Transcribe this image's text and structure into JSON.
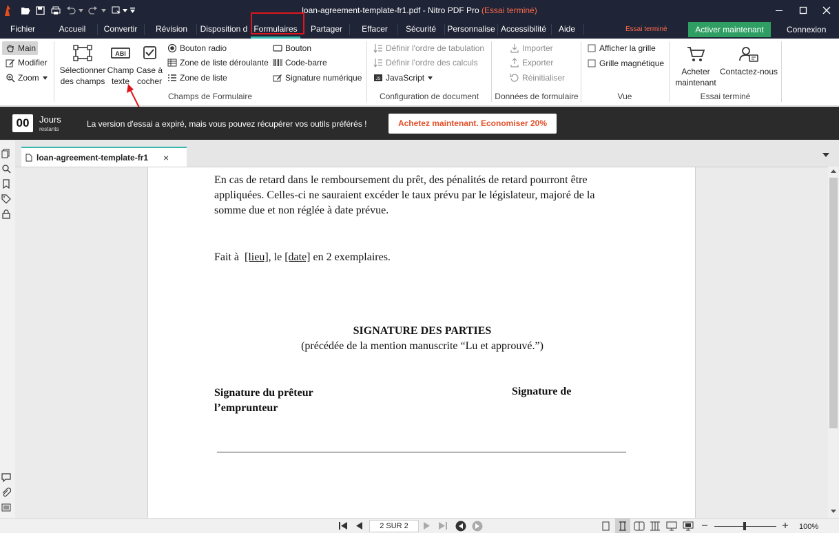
{
  "titlebar": {
    "filename": "loan-agreement-template-fr1.pdf - Nitro PDF Pro ",
    "trial": "(Essai terminé)"
  },
  "menu": {
    "tabs": [
      "Fichier",
      "Accueil",
      "Convertir",
      "Révision",
      "Disposition d",
      "Formulaires",
      "Partager",
      "Effacer",
      "Sécurité",
      "Personnalise",
      "Accessibilité",
      "Aide"
    ],
    "active": "Formulaires",
    "trial_label": "Essai terminé",
    "activate_label": "Activer maintenant",
    "connexion_label": "Connexion"
  },
  "ribbon": {
    "tools": {
      "main": "Main",
      "modifier": "Modifier",
      "zoom": "Zoom"
    },
    "fields": {
      "select_line1": "Sélectionner",
      "select_line2": "des champs",
      "text_line1": "Champ",
      "text_line2": "texte",
      "check_line1": "Case à",
      "check_line2": "cocher",
      "radio": "Bouton radio",
      "dropdown": "Zone de liste déroulante",
      "listbox": "Zone de liste",
      "button": "Bouton",
      "barcode": "Code-barre",
      "signature": "Signature numérique",
      "group": "Champs de Formulaire"
    },
    "docconfig": {
      "tab_order": "Définir l'ordre de tabulation",
      "calc_order": "Définir l'ordre des calculs",
      "javascript": "JavaScript",
      "group": "Configuration de document"
    },
    "formdata": {
      "import": "Importer",
      "export": "Exporter",
      "reset": "Réinitialiser",
      "group": "Données de formulaire"
    },
    "view": {
      "grid": "Afficher la grille",
      "magnetic": "Grille magnétique",
      "group": "Vue"
    },
    "trial": {
      "buy_line1": "Acheter",
      "buy_line2": "maintenant",
      "contact": "Contactez-nous",
      "group": "Essai terminé"
    }
  },
  "banner": {
    "days": "00",
    "days_label": "Jours",
    "days_sub": "restants",
    "message": "La version d'essai a expiré, mais vous pouvez récupérer vos outils préférés !",
    "buy": "Achetez maintenant. Economiser 20%"
  },
  "doctab": {
    "name": "loan-agreement-template-fr1",
    "close": "×"
  },
  "document": {
    "paragraph": "En cas de retard dans le remboursement du prêt, des pénalités de retard pourront être appliquées. Celles-ci ne sauraient excéder le taux prévu par le législateur, majoré de la somme due et non réglée à date prévue.",
    "fait_prefix": "Fait à ",
    "lieu": "[lieu]",
    "fait_mid": ", le ",
    "date": "[date]",
    "fait_suffix": " en 2 exemplaires.",
    "sig_title": "SIGNATURE DES PARTIES",
    "sig_sub": "(précédée de la mention manuscrite “Lu et approuvé.”)",
    "sig_lender": "Signature du prêteur",
    "sig_borrower_line2": "l’emprunteur",
    "sig_right": "Signature de"
  },
  "statusbar": {
    "page": "2 SUR 2",
    "zoom": "100%"
  },
  "colors": {
    "titlebar": "#1f2436",
    "accent": "#37b6b0",
    "activate": "#2e9e63",
    "highlight": "#e0161c",
    "trial": "#ff6a4d"
  }
}
